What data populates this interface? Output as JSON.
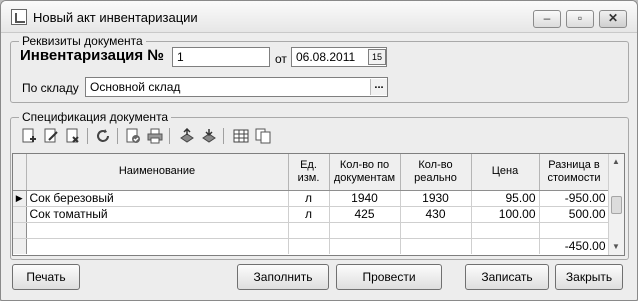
{
  "window": {
    "title": "Новый акт инвентаризации"
  },
  "title_buttons": {
    "minimize": "–",
    "maximize": "▫",
    "close": "✕"
  },
  "requisites": {
    "group_label": "Реквизиты документа",
    "inventory_label": "Инвентаризация №",
    "number_value": "1",
    "date_label": "от",
    "date_value": "06.08.2011",
    "warehouse_label": "По складу",
    "warehouse_value": "Основной склад",
    "picker_icon": "15",
    "ellipsis": "..."
  },
  "spec": {
    "group_label": "Спецификация документа",
    "toolbar_icons": [
      "add-row-icon",
      "edit-row-icon",
      "delete-row-icon",
      "refresh-icon",
      "check-icon",
      "print-icon",
      "move-up-icon",
      "move-down-icon",
      "table-icon",
      "copy-icon"
    ]
  },
  "table": {
    "columns": [
      "Наименование",
      "Ед. изм.",
      "Кол-во по документам",
      "Кол-во реально",
      "Цена",
      "Разница в стоимости"
    ],
    "rows": [
      {
        "indicator": "▶",
        "name": "Сок березовый",
        "unit": "л",
        "doc_qty": "1940",
        "real_qty": "1930",
        "price": "95.00",
        "diff": "-950.00"
      },
      {
        "indicator": "",
        "name": "Сок томатный",
        "unit": "л",
        "doc_qty": "425",
        "real_qty": "430",
        "price": "100.00",
        "diff": "500.00"
      }
    ],
    "total_diff": "-450.00"
  },
  "buttons": {
    "print": "Печать",
    "fill": "Заполнить",
    "post": "Провести",
    "save": "Записать",
    "close": "Закрыть"
  }
}
